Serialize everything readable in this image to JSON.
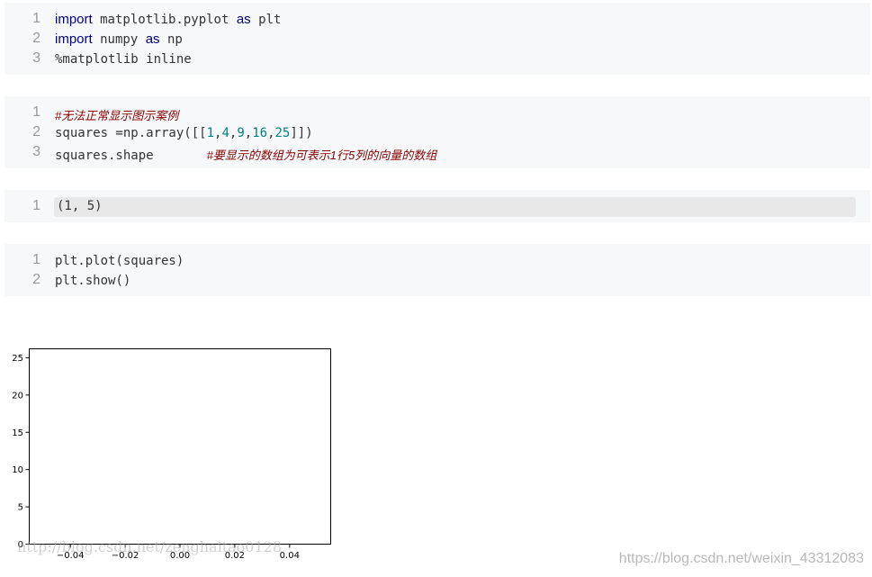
{
  "cells": [
    {
      "lines": [
        {
          "n": "1",
          "kw": "import",
          "rest": " matplotlib.pyplot ",
          "kw2": "as",
          "rest2": " plt"
        },
        {
          "n": "2",
          "kw": "import",
          "rest": " numpy ",
          "kw2": "as",
          "rest2": " np"
        },
        {
          "n": "3",
          "text": "%matplotlib inline"
        }
      ]
    },
    {
      "lines": [
        {
          "n": "1",
          "comment": "#无法正常显示图示案例"
        },
        {
          "n": "2",
          "pre": "squares =np.array([[",
          "nums": [
            "1",
            "4",
            "9",
            "16",
            "25"
          ],
          "post": "]])"
        },
        {
          "n": "3",
          "code": "squares.shape       ",
          "comment": "#要显示的数组为可表示1行5列的向量的数组"
        }
      ]
    },
    {
      "lines": [
        {
          "n": "1",
          "text": "(1, 5)"
        }
      ]
    },
    {
      "lines": [
        {
          "n": "1",
          "text": "plt.plot(squares)"
        },
        {
          "n": "2",
          "text": "plt.show()"
        }
      ]
    }
  ],
  "chart_data": {
    "type": "line",
    "x": [
      0,
      0,
      0,
      0,
      0
    ],
    "series": [],
    "xlim": [
      -0.055,
      0.055
    ],
    "ylim": [
      0,
      26.2
    ],
    "xticks": [
      "−0.04",
      "−0.02",
      "0.00",
      "0.02",
      "0.04"
    ],
    "xtick_values": [
      -0.04,
      -0.02,
      0.0,
      0.02,
      0.04
    ],
    "yticks": [
      "0",
      "5",
      "10",
      "15",
      "20",
      "25"
    ],
    "ytick_values": [
      0,
      5,
      10,
      15,
      20,
      25
    ],
    "grid": false
  },
  "watermarks": {
    "left": "http://blog.csdn.net/zenghaitao0128",
    "right": "https://blog.csdn.net/weixin_43312083"
  }
}
